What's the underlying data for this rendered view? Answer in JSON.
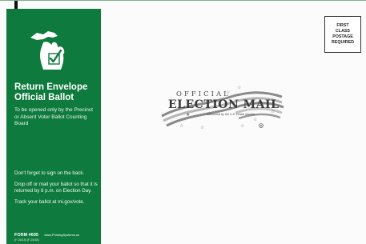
{
  "sidebar": {
    "title_line1": "Return Envelope",
    "title_line2": "Official Ballot",
    "subtitle": "To be opened only by the Precinct or Absent Voter Ballot Counting Board",
    "note_sign": "Don't forget to sign on the back.",
    "note_drop": "Drop off or mail your ballot so that it is returned by 8 p.m. on Election Day.",
    "note_track": "Track your ballot at mi.gov/vote.",
    "form_code": "FORM #695",
    "vendor": "www.PrintingSystems.us",
    "codes": "(F-26/18) (F-25/18)"
  },
  "postage": {
    "line1": "FIRST",
    "line2": "CLASS",
    "line3": "POSTAGE",
    "line4": "REQUIRED"
  },
  "logo": {
    "official": "OFFICIAL",
    "election_mail": "ELECTION MAIL",
    "authorized": "Authorized by the U.S. Postal Service"
  },
  "colors": {
    "sidebar_green": "#0e7a3d",
    "map_white": "#ffffff",
    "check_green": "#0e7a3d"
  },
  "icons": [
    "michigan-map-icon",
    "checkbox-check-icon",
    "flag-swoosh-icon",
    "star-icon",
    "registered-mark-icon"
  ]
}
